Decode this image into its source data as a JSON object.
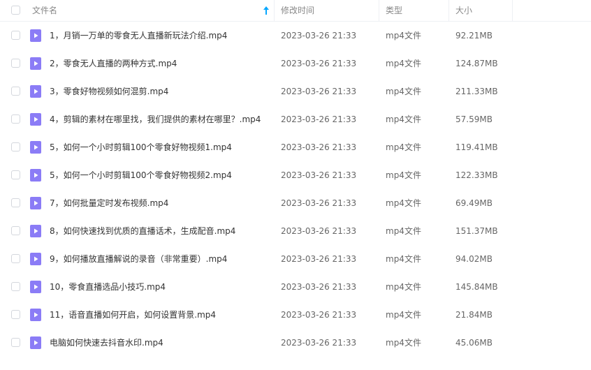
{
  "header": {
    "name": "文件名",
    "modified": "修改时间",
    "type": "类型",
    "size": "大小"
  },
  "colors": {
    "accent": "#06a7ff",
    "file_icon": "#8b7cf6",
    "text": "#333333",
    "muted": "#888888"
  },
  "files": [
    {
      "name": "1，月销一万单的零食无人直播新玩法介绍.mp4",
      "modified": "2023-03-26 21:33",
      "type": "mp4文件",
      "size": "92.21MB"
    },
    {
      "name": "2，零食无人直播的两种方式.mp4",
      "modified": "2023-03-26 21:33",
      "type": "mp4文件",
      "size": "124.87MB"
    },
    {
      "name": "3，零食好物视频如何混剪.mp4",
      "modified": "2023-03-26 21:33",
      "type": "mp4文件",
      "size": "211.33MB"
    },
    {
      "name": "4，剪辑的素材在哪里找，我们提供的素材在哪里？.mp4",
      "modified": "2023-03-26 21:33",
      "type": "mp4文件",
      "size": "57.59MB"
    },
    {
      "name": "5，如何一个小时剪辑100个零食好物视频1.mp4",
      "modified": "2023-03-26 21:33",
      "type": "mp4文件",
      "size": "119.41MB"
    },
    {
      "name": "5，如何一个小时剪辑100个零食好物视频2.mp4",
      "modified": "2023-03-26 21:33",
      "type": "mp4文件",
      "size": "122.33MB"
    },
    {
      "name": "7，如何批量定时发布视频.mp4",
      "modified": "2023-03-26 21:33",
      "type": "mp4文件",
      "size": "69.49MB"
    },
    {
      "name": "8，如何快速找到优质的直播话术，生成配音.mp4",
      "modified": "2023-03-26 21:33",
      "type": "mp4文件",
      "size": "151.37MB"
    },
    {
      "name": "9，如何播放直播解说的录音（非常重要）.mp4",
      "modified": "2023-03-26 21:33",
      "type": "mp4文件",
      "size": "94.02MB"
    },
    {
      "name": "10，零食直播选品小技巧.mp4",
      "modified": "2023-03-26 21:33",
      "type": "mp4文件",
      "size": "145.84MB"
    },
    {
      "name": "11，语音直播如何开启，如何设置背景.mp4",
      "modified": "2023-03-26 21:33",
      "type": "mp4文件",
      "size": "21.84MB"
    },
    {
      "name": "电脑如何快速去抖音水印.mp4",
      "modified": "2023-03-26 21:33",
      "type": "mp4文件",
      "size": "45.06MB"
    }
  ]
}
